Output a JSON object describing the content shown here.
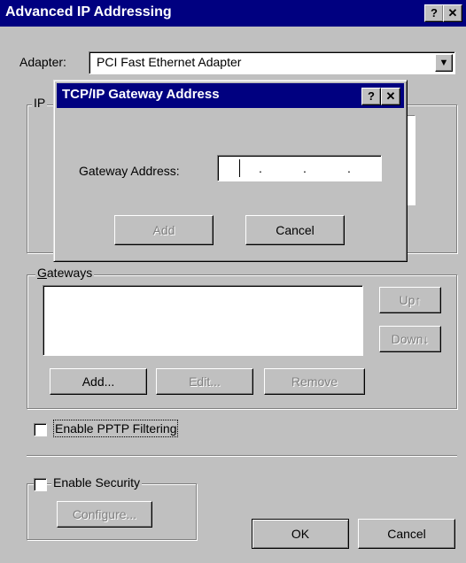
{
  "window": {
    "title": "Advanced IP Addressing",
    "help_glyph": "?",
    "close_glyph": "✕"
  },
  "adapter": {
    "label": "Adapter:",
    "value": "PCI Fast Ethernet Adapter",
    "dropdown_glyph": "▼"
  },
  "ip_group": {
    "label": "IP"
  },
  "dialog": {
    "title": "TCP/IP Gateway Address",
    "help_glyph": "?",
    "close_glyph": "✕",
    "gateway_label": "Gateway Address:",
    "ip_dots": [
      ".",
      ".",
      "."
    ],
    "add_label": "Add",
    "cancel_label": "Cancel"
  },
  "gateways": {
    "label": "Gateways",
    "up_label": "Up↑",
    "down_label": "Down↓",
    "add_label": "Add...",
    "edit_label": "Edit...",
    "remove_label": "Remove"
  },
  "pptp": {
    "label": "Enable PPTP Filtering",
    "checked": false
  },
  "security": {
    "label": "Enable Security",
    "checked": false,
    "configure_label": "Configure..."
  },
  "footer": {
    "ok_label": "OK",
    "cancel_label": "Cancel"
  },
  "colors": {
    "titlebar": "#000080",
    "face": "#c0c0c0",
    "shadow": "#808080"
  }
}
